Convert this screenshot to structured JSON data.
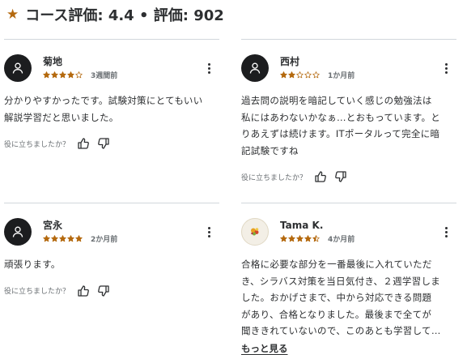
{
  "header": {
    "star_icon": "star-icon",
    "title": "コース評価: 4.4 • 評価: 902"
  },
  "accent_color": "#b4690e",
  "helpful_prompt": "役に立ちましたか？",
  "reviews": [
    {
      "name": "菊地",
      "rating": 4,
      "time": "3週間前",
      "avatar": "user-icon",
      "lines": [
        "分かりやすかったです。試験対策にとてもいい",
        "解説学習だと思いました。"
      ]
    },
    {
      "name": "西村",
      "rating": 2,
      "time": "1か月前",
      "avatar": "user-icon",
      "lines": [
        "過去問の説明を暗記していく感じの勉強法は",
        "私にはあわないかなぁ…とおもっています。と",
        "りあえずは続けます。ITポータルって完全に暗",
        "記試験ですね"
      ]
    },
    {
      "name": "宮永",
      "rating": 5,
      "time": "2か月前",
      "avatar": "user-icon",
      "lines": [
        "頑張ります。"
      ]
    },
    {
      "name": "Tama K.",
      "rating": 4.5,
      "time": "4か月前",
      "avatar": "fruit-photo-avatar",
      "lines": [
        "合格に必要な部分を一番最後に入れていただ",
        "き、シラバス対策を当日気付き、２週学習しま",
        "した。おかげさまで、中から対応できる問題",
        "があり、合格となりました。最後まで全てが",
        "聞ききれていないので、このあとも学習して…"
      ],
      "show_more": "もっと見る"
    }
  ]
}
